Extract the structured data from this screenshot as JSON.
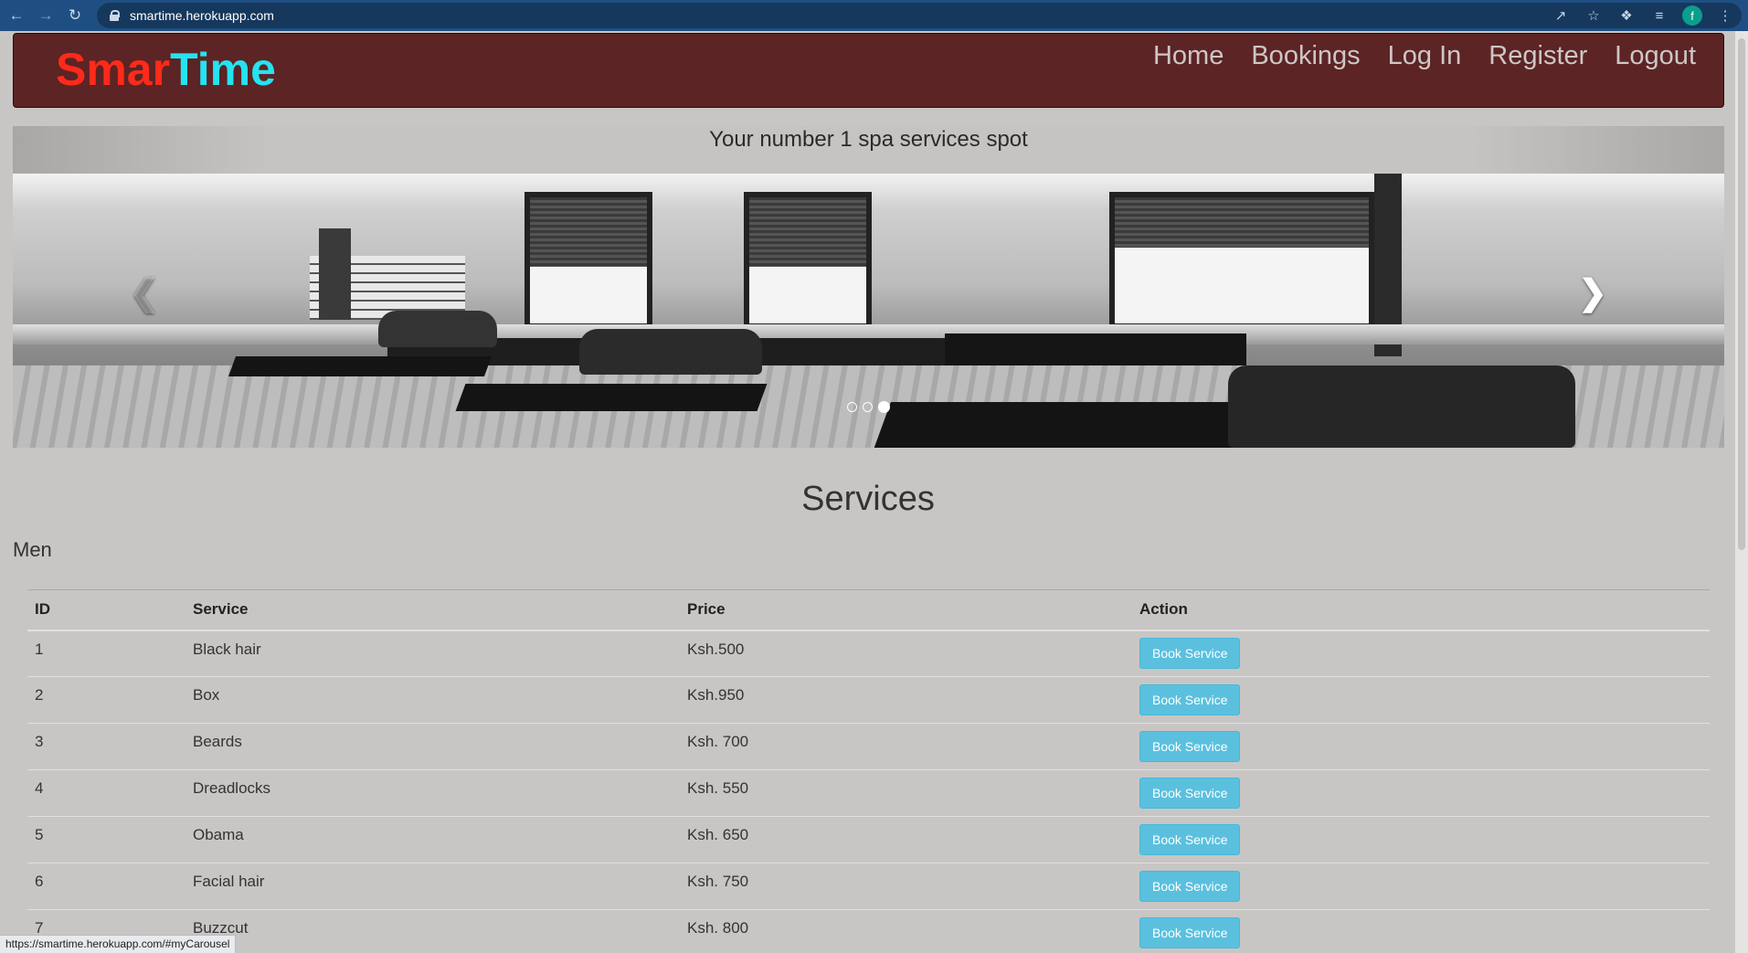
{
  "browser": {
    "url": "smartime.herokuapp.com",
    "profile_initial": "f",
    "status_link": "https://smartime.herokuapp.com/#myCarousel"
  },
  "navbar": {
    "brand_part1": "Smar",
    "brand_part2": "Time",
    "links": [
      "Home",
      "Bookings",
      "Log In",
      "Register",
      "Logout"
    ]
  },
  "carousel": {
    "caption": "Your number 1 spa services spot",
    "slide_count": 3,
    "active_slide": 3
  },
  "services": {
    "title": "Services",
    "category": "Men",
    "columns": [
      "ID",
      "Service",
      "Price",
      "Action"
    ],
    "rows": [
      {
        "id": "1",
        "service": "Black hair",
        "price": "Ksh.500",
        "action": "Book Service"
      },
      {
        "id": "2",
        "service": "Box",
        "price": "Ksh.950",
        "action": "Book Service"
      },
      {
        "id": "3",
        "service": "Beards",
        "price": "Ksh. 700",
        "action": "Book Service"
      },
      {
        "id": "4",
        "service": "Dreadlocks",
        "price": "Ksh. 550",
        "action": "Book Service"
      },
      {
        "id": "5",
        "service": "Obama",
        "price": "Ksh. 650",
        "action": "Book Service"
      },
      {
        "id": "6",
        "service": "Facial hair",
        "price": "Ksh. 750",
        "action": "Book Service"
      },
      {
        "id": "7",
        "service": "Buzzcut",
        "price": "Ksh. 800",
        "action": "Book Service"
      }
    ]
  },
  "colors": {
    "navbar_bg": "#5c2424",
    "brand_red": "#ff2a1a",
    "brand_cyan": "#25e3f0",
    "button_info": "#5bc0de",
    "page_bg": "#c8c6c4"
  }
}
